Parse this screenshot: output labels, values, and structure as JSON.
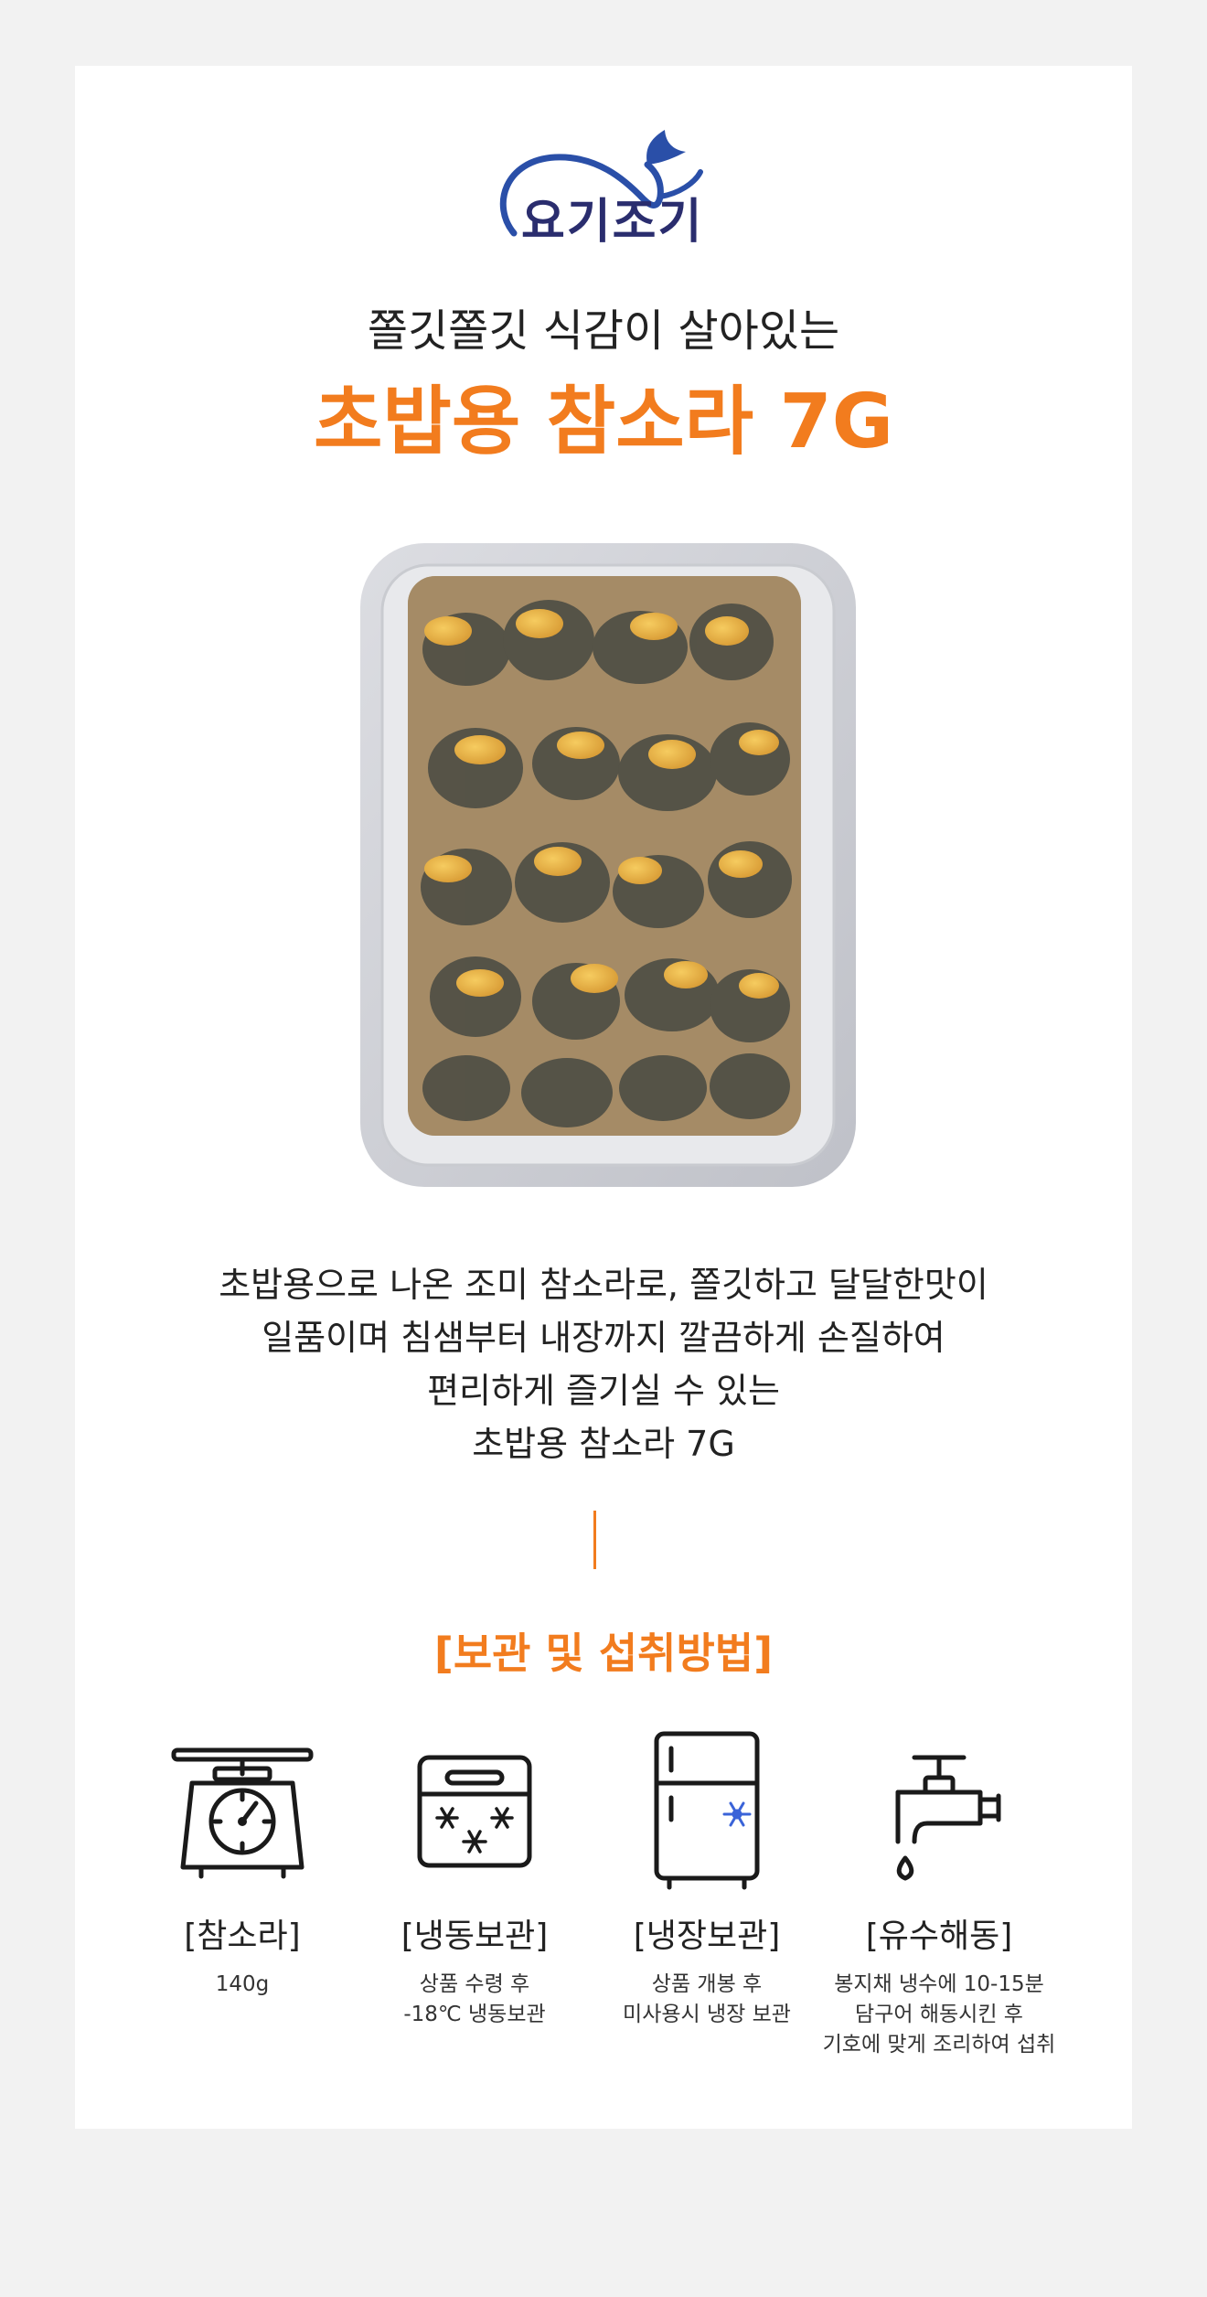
{
  "brand": {
    "logo_text": "요기조기"
  },
  "header": {
    "subtitle": "쫄깃쫄깃 식감이 살아있는",
    "title": "초밥용 참소라 7G"
  },
  "description": {
    "lines": [
      "초밥용으로 나온 조미 참소라로, 쫄깃하고 달달한맛이",
      "일품이며 침샘부터 내장까지 깔끔하게 손질하여",
      "편리하게 즐기실 수 있는",
      "초밥용 참소라 7G"
    ]
  },
  "section": {
    "title": "[보관 및 섭취방법]"
  },
  "info_items": [
    {
      "icon": "scale-icon",
      "label": "[참소라]",
      "desc": [
        "140g"
      ]
    },
    {
      "icon": "freezer-box-icon",
      "label": "[냉동보관]",
      "desc": [
        "상품 수령 후",
        "-18℃ 냉동보관"
      ]
    },
    {
      "icon": "refrigerator-icon",
      "label": "[냉장보관]",
      "desc": [
        "상품 개봉 후",
        "미사용시 냉장 보관"
      ]
    },
    {
      "icon": "faucet-icon",
      "label": "[유수해동]",
      "desc": [
        "봉지채 냉수에 10-15분",
        "담구어 해동시킨 후",
        "기호에 맞게 조리하여 섭취"
      ]
    }
  ],
  "colors": {
    "accent": "#f27c1e",
    "logo_blue": "#2a4fa8",
    "logo_text": "#2a2d6e",
    "background": "#f2f2f2",
    "card": "#ffffff"
  }
}
